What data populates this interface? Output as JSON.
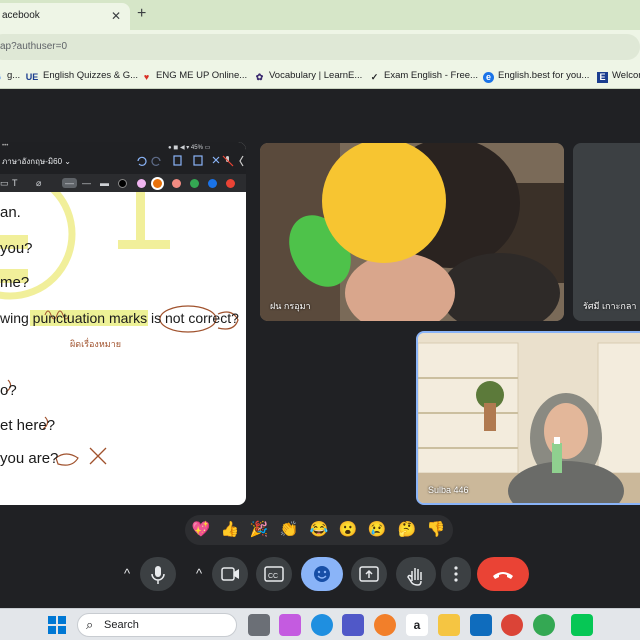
{
  "browser": {
    "tab_title": "acebook",
    "tab_close": "✕",
    "new_tab": "+",
    "url": "ap?authuser=0",
    "bookmarks": [
      {
        "icon": "G",
        "label": "g..."
      },
      {
        "icon": "UE",
        "label": "English Quizzes & G..."
      },
      {
        "icon": "♥",
        "label": "ENG ME UP Online..."
      },
      {
        "icon": "✿",
        "label": "Vocabulary | LearnE..."
      },
      {
        "icon": "✓",
        "label": "Exam English - Free..."
      },
      {
        "icon": "e",
        "label": "English.best for you..."
      },
      {
        "icon": "E",
        "label": "Welcom"
      }
    ]
  },
  "presentation": {
    "ipad_title": "ภาษาอังกฤษ-มิ60 ⌄",
    "ipad_status": "● ◼ ◀ ▾ 45% ▭",
    "lines": [
      "an.",
      "you?",
      "me?",
      "wing punctuation marks is not correct?",
      "o?",
      "et here?",
      "you are?"
    ],
    "handwriting": "ผิดเรื่องหมาย"
  },
  "participants": [
    {
      "name": "ฝน กรอุมา"
    },
    {
      "name": "รัศมี เกาะกลา"
    },
    {
      "name": "Sulba 446"
    }
  ],
  "reactions": [
    "💖",
    "👍",
    "🎉",
    "👏",
    "😂",
    "😮",
    "😢",
    "🤔",
    "👎"
  ],
  "controls": {
    "chevron": "^",
    "colors": {
      "end_call": "#ea4335",
      "active": "#8ab4f8",
      "control": "#3c4043"
    }
  },
  "taskbar": {
    "search_placeholder": "Search"
  }
}
